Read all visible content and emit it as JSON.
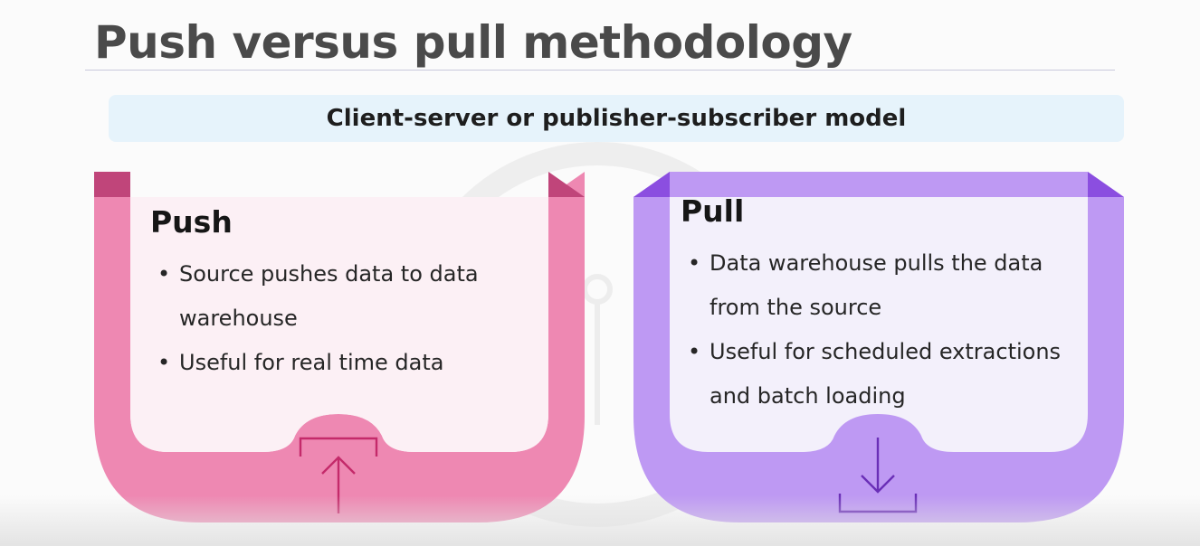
{
  "title": "Push versus pull methodology",
  "subtitle": "Client-server or publisher-subscriber model",
  "panels": [
    {
      "heading": "Push",
      "bullets": [
        "Source pushes data to data warehouse",
        "Useful for real time data"
      ],
      "icon": "upload-arrow-icon",
      "frame_color": "#ee88b2",
      "fold_color": "#c0457a",
      "fill_color": "#fcf0f5",
      "icon_color": "#c42a6a"
    },
    {
      "heading": "Pull",
      "bullets": [
        "Data warehouse pulls the data from the source",
        "Useful for scheduled extractions and batch loading"
      ],
      "icon": "download-arrow-icon",
      "frame_color": "#be99f3",
      "fold_color": "#8b4ee0",
      "fill_color": "#f3f0fb",
      "icon_color": "#6a2fb7"
    }
  ]
}
